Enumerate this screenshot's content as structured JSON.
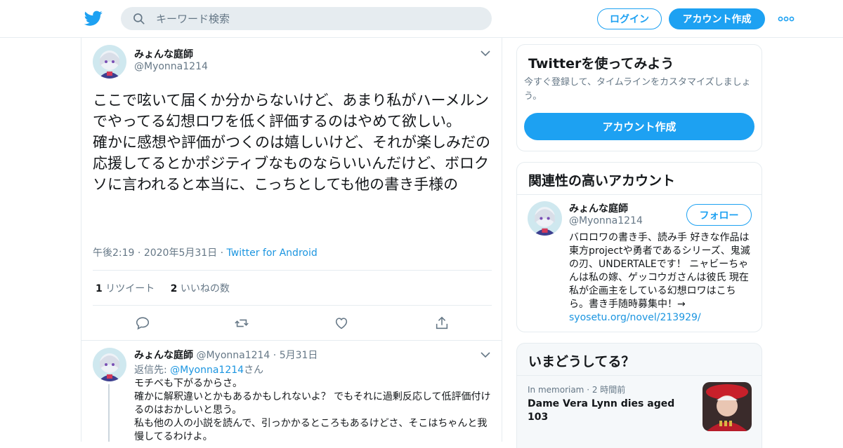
{
  "header": {
    "search_placeholder": "キーワード検索",
    "login_label": "ログイン",
    "signup_label": "アカウント作成"
  },
  "tweet": {
    "name": "みょんな庭師",
    "handle": "@Myonna1214",
    "text": "ここで呟いて届くか分からないけど、あまり私がハーメルンでやってる幻想ロワを低く評価するのはやめて欲しい。\n確かに感想や評価がつくのは嬉しいけど、それが楽しみだの応援してるとかポジティブなものならいいんだけど、ボロクソに言われると本当に、こっちとしても他の書き手様の",
    "time": "午後2:19",
    "date": "2020年5月31日",
    "source": "Twitter for Android",
    "retweet_count": "1",
    "retweet_label": "リツイート",
    "like_count": "2",
    "like_label": "いいねの数"
  },
  "reply": {
    "name": "みょんな庭師",
    "handle": "@Myonna1214",
    "date": "5月31日",
    "reply_to_prefix": "返信先: ",
    "reply_to_handle": "@Myonna1214",
    "reply_to_suffix": "さん",
    "text": "モチベも下がるからさ。\n確かに解釈違いとかもあるかもしれないよ？ でもそれに過剰反応して低評価付けるのはおかしいと思う。\n私も他の人の小説を読んで、引っかかるところもあるけどさ、そこはちゃんと我慢してるわけよ。"
  },
  "sidebar": {
    "try": {
      "title": "Twitterを使ってみよう",
      "desc": "今すぐ登録して、タイムラインをカスタマイズしましょう。",
      "button": "アカウント作成"
    },
    "related": {
      "title": "関連性の高いアカウント",
      "name": "みょんな庭師",
      "handle": "@Myonna1214",
      "follow_label": "フォロー",
      "bio": "バロロワの書き手、読み手 好きな作品は東方projectや勇者であるシリーズ、鬼滅の刃、UNDERTALEです！ ニャビーちゃんは私の嫁、ゲッコウガさんは彼氏 現在私が企画主をしている幻想ロワはこちら。書き手随時募集中！→ ",
      "link": "syosetu.org/novel/213929/"
    },
    "trends": {
      "title": "いまどうしてる？",
      "category": "In memoriam",
      "time": "2 時間前",
      "headline": "Dame Vera Lynn dies aged 103"
    }
  },
  "colors": {
    "accent": "#1da1f2",
    "link": "#1b95e0",
    "muted": "#657786",
    "border": "#e6ecf0"
  }
}
